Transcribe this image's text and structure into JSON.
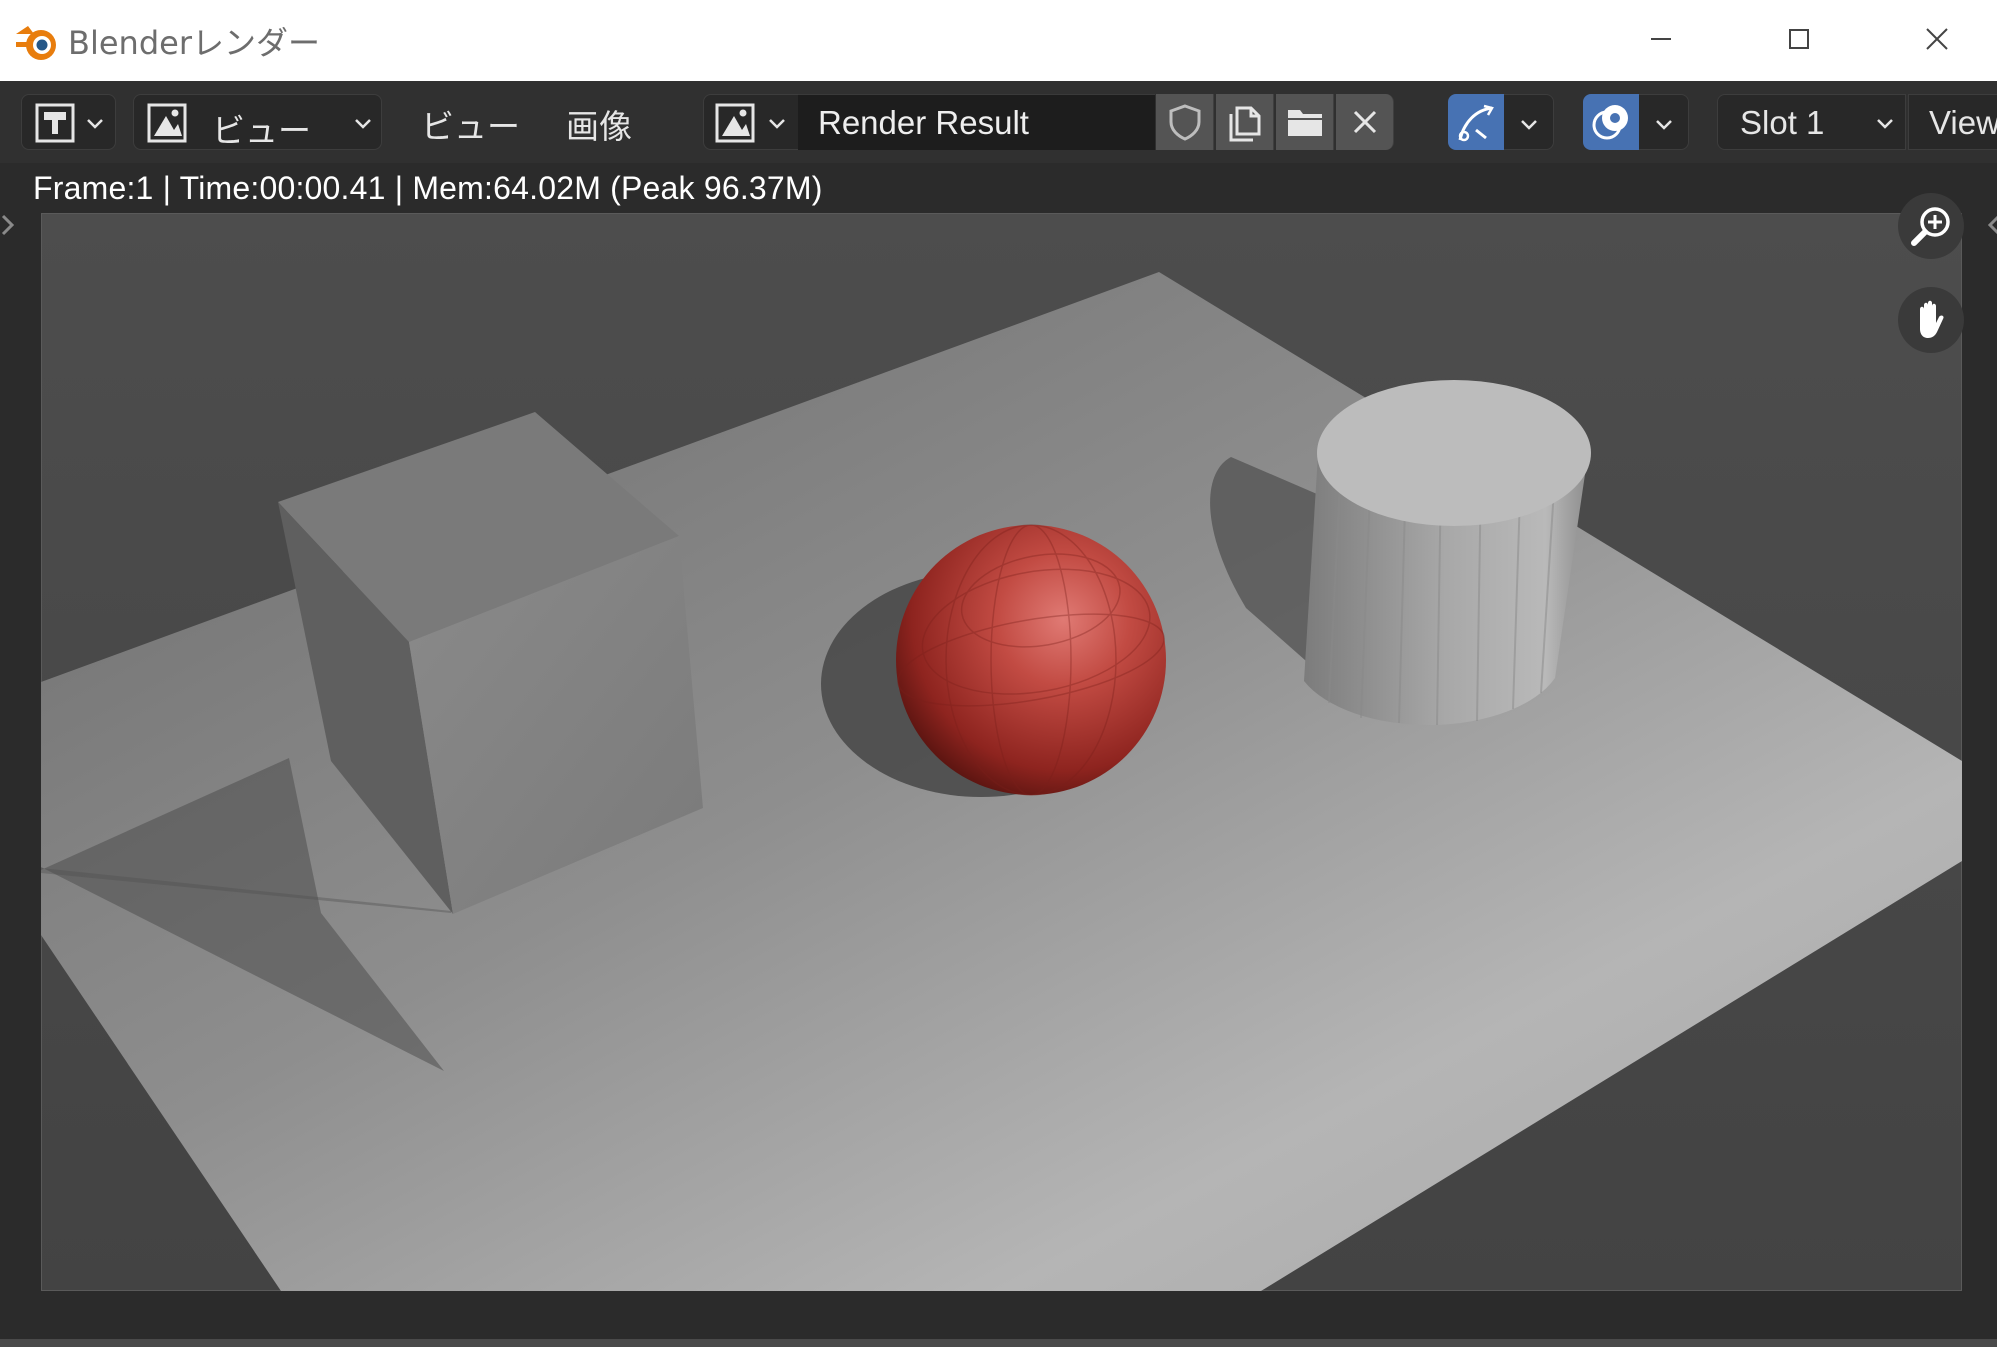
{
  "window": {
    "title": "Blenderレンダー",
    "logo_icon": "blender-logo",
    "controls": [
      "minimize-icon",
      "maximize-icon",
      "close-icon"
    ]
  },
  "header": {
    "editor_type_icon": "image-editor-icon",
    "view_mode": {
      "icon": "image-icon",
      "label": "ビュー"
    },
    "menus": [
      "ビュー",
      "画像"
    ],
    "image_browse_icon": "image-browse-icon",
    "image_name": "Render Result",
    "image_actions": [
      "fake-user-shield-icon",
      "new-image-icon",
      "open-image-icon",
      "unlink-close-icon"
    ],
    "gizmo_toggle_icon": "gizmo-icon",
    "overlay_toggle_icon": "overlay-icon",
    "slot": "Slot 1",
    "view_layer": "View"
  },
  "render_info": "Frame:1 | Time:00:00.41 | Mem:64.02M (Peak 96.37M)",
  "viewport_nav": [
    "zoom-in-icon",
    "hand-pan-icon"
  ],
  "colors": {
    "accent": "#4772b3",
    "header_bg": "#303030",
    "editor_bg": "#2b2b2b",
    "sphere": "#b83a33",
    "logo_orange": "#e87d0d"
  }
}
